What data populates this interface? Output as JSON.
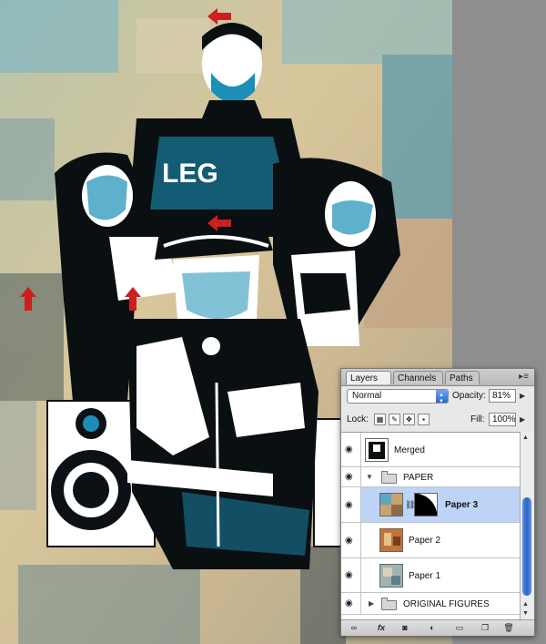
{
  "layers_panel": {
    "tabs": [
      "Layers",
      "Channels",
      "Paths"
    ],
    "blend_mode": "Normal",
    "opacity_label": "Opacity:",
    "opacity_value": "81%",
    "lock_label": "Lock:",
    "fill_label": "Fill:",
    "fill_value": "100%",
    "layers": [
      {
        "name": "Merged",
        "type": "layer",
        "visible": true,
        "selected": false
      },
      {
        "name": "PAPER",
        "type": "group",
        "expanded": true,
        "visible": true,
        "selected": false
      },
      {
        "name": "Paper 3",
        "type": "layer",
        "has_mask": true,
        "visible": true,
        "selected": true
      },
      {
        "name": "Paper 2",
        "type": "layer",
        "visible": true,
        "selected": false
      },
      {
        "name": "Paper 1",
        "type": "layer",
        "visible": true,
        "selected": false
      },
      {
        "name": "ORIGINAL FIGURES",
        "type": "group",
        "expanded": false,
        "visible": true,
        "selected": false
      }
    ],
    "bottom_buttons": [
      "link-icon",
      "fx-icon",
      "mask-icon",
      "adjustment-icon",
      "new-group-icon",
      "new-layer-icon",
      "trash-icon"
    ]
  },
  "canvas": {
    "accent_colors": {
      "arrow_red": "#cc1f1f",
      "figure_cyan": "#1b8fb5",
      "figure_black": "#0a0f12"
    }
  }
}
